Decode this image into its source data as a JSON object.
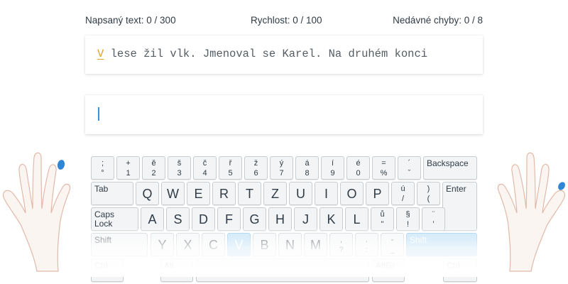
{
  "stats": {
    "typed": "Napsaný text: 0 / 300",
    "speed": "Rychlost: 0 / 100",
    "errors": "Nedávné chyby: 0 / 8"
  },
  "text": {
    "current_char": "V",
    "rest": " lese žil vlk. Jmenoval se Karel. Na druhém konci"
  },
  "input": {
    "value": ""
  },
  "keyboard": {
    "row1": [
      {
        "top": ";",
        "bot": "°"
      },
      {
        "top": "+",
        "bot": "1"
      },
      {
        "top": "ě",
        "bot": "2"
      },
      {
        "top": "š",
        "bot": "3"
      },
      {
        "top": "č",
        "bot": "4"
      },
      {
        "top": "ř",
        "bot": "5"
      },
      {
        "top": "ž",
        "bot": "6"
      },
      {
        "top": "ý",
        "bot": "7"
      },
      {
        "top": "á",
        "bot": "8"
      },
      {
        "top": "í",
        "bot": "9"
      },
      {
        "top": "é",
        "bot": "0"
      },
      {
        "top": "=",
        "bot": "%"
      },
      {
        "top": "´",
        "bot": "ˇ"
      }
    ],
    "backspace": "Backspace",
    "tab": "Tab",
    "row2": [
      "Q",
      "W",
      "E",
      "R",
      "T",
      "Z",
      "U",
      "I",
      "O",
      "P"
    ],
    "row2_sym": [
      {
        "top": "ú",
        "bot": "/"
      },
      {
        "top": ")",
        "bot": "("
      }
    ],
    "enter": "Enter",
    "caps": "Caps\nLock",
    "row3": [
      "A",
      "S",
      "D",
      "F",
      "G",
      "H",
      "J",
      "K",
      "L"
    ],
    "row3_sym": [
      {
        "top": "ů",
        "bot": "\""
      },
      {
        "top": "§",
        "bot": "!"
      },
      {
        "top": "¨",
        "bot": "'"
      }
    ],
    "shift_left": "Shift",
    "row4": [
      "Y",
      "X",
      "C",
      "V",
      "B",
      "N",
      "M"
    ],
    "row4_sym": [
      {
        "top": ",",
        "bot": "?"
      },
      {
        "top": ".",
        "bot": ":"
      },
      {
        "top": "-",
        "bot": "_"
      }
    ],
    "shift_right": "Shift",
    "ctrl": "Ctrl",
    "alt": "Alt",
    "altgr": "AltGr",
    "highlighted_key": "V",
    "highlight_color": "#88c3ee"
  },
  "colors": {
    "accent": "#3a8fd6",
    "current_char": "#e4a12a",
    "finger_dot": "#2f86d4"
  }
}
